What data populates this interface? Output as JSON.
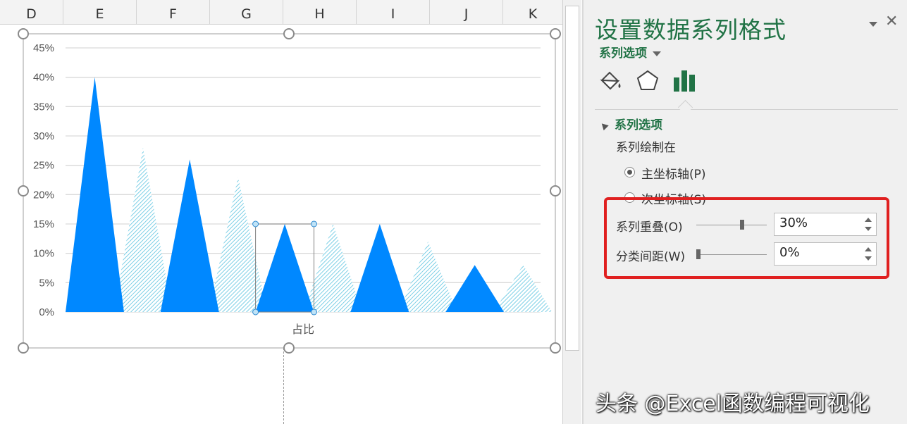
{
  "columns": [
    "D",
    "E",
    "F",
    "G",
    "H",
    "I",
    "J",
    "K"
  ],
  "pane": {
    "title": "设置数据系列格式",
    "subtitle": "系列选项",
    "tabs": [
      "fill-line-icon",
      "effects-pentagon-icon",
      "series-options-bar-icon"
    ],
    "section": "系列选项",
    "plot_on_label": "系列绘制在",
    "primary_axis": "主坐标轴(P)",
    "secondary_axis": "次坐标轴(S)",
    "overlap_label": "系列重叠(O)",
    "overlap_value": "30%",
    "overlap_level": 0.3,
    "gap_label": "分类间距(W)",
    "gap_value": "0%",
    "gap_level": 0.0
  },
  "colors": {
    "accent": "#217346",
    "series_solid": "#0088ff",
    "series_hatch": "#9fd8e8",
    "highlight_box": "#e02020"
  },
  "chart_data": {
    "type": "area",
    "subtype": "triangle-column",
    "xlabel": "占比",
    "yticks": [
      "0%",
      "5%",
      "10%",
      "15%",
      "20%",
      "25%",
      "30%",
      "35%",
      "40%",
      "45%"
    ],
    "ylim": [
      0,
      45
    ],
    "grid": true,
    "series": [
      {
        "style": "solid",
        "values": [
          40,
          26,
          15,
          15,
          8
        ]
      },
      {
        "style": "hatched",
        "values": [
          28,
          23,
          15,
          12,
          8
        ]
      }
    ],
    "selected_point_value": 15
  },
  "watermark": "头条 @Excel函数编程可视化"
}
